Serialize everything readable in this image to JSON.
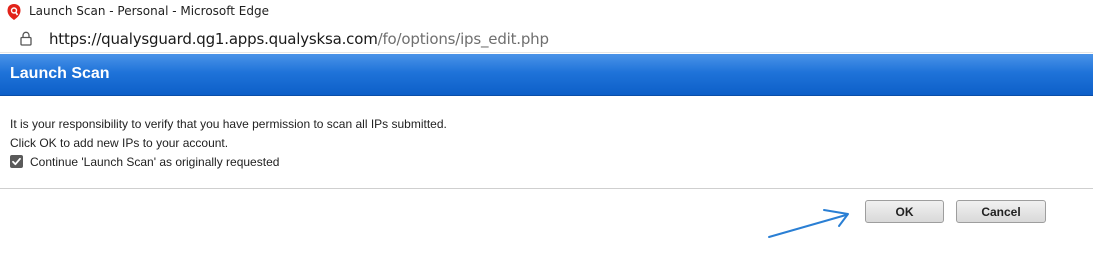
{
  "window": {
    "title": "Launch Scan - Personal - Microsoft Edge",
    "icon": "qualys-shield-icon"
  },
  "address_bar": {
    "url_host": "https://qualysguard.qg1.apps.qualysksa.com",
    "url_path": "/fo/options/ips_edit.php",
    "lock_icon": "lock-icon"
  },
  "dialog": {
    "title": "Launch Scan",
    "message_line1": "It is your responsibility to verify that you have permission to scan all IPs submitted.",
    "message_line2": "Click OK to add new IPs to your account.",
    "checkbox_label": "Continue 'Launch Scan' as originally requested",
    "checkbox_checked": true
  },
  "buttons": {
    "ok_label": "OK",
    "cancel_label": "Cancel"
  },
  "colors": {
    "header_blue": "#1f73d9",
    "annotation_arrow": "#2a7fd4"
  }
}
